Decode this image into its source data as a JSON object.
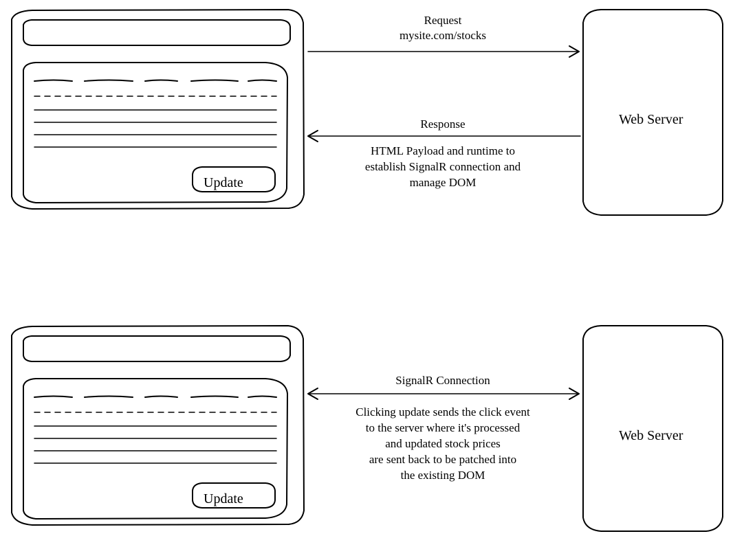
{
  "top": {
    "browser": {
      "button": "Update"
    },
    "server": {
      "label": "Web Server"
    },
    "request": {
      "line1": "Request",
      "line2": "mysite.com/stocks"
    },
    "response": {
      "label": "Response",
      "desc1": "HTML Payload and runtime to",
      "desc2": "establish SignalR connection and",
      "desc3": "manage DOM"
    }
  },
  "bottom": {
    "browser": {
      "button": "Update"
    },
    "server": {
      "label": "Web Server"
    },
    "signalr": {
      "label": "SignalR Connection",
      "desc1": "Clicking update sends the click event",
      "desc2": "to the server where it's processed",
      "desc3": "and updated stock prices",
      "desc4": "are sent back to be patched into",
      "desc5": "the existing DOM"
    }
  }
}
